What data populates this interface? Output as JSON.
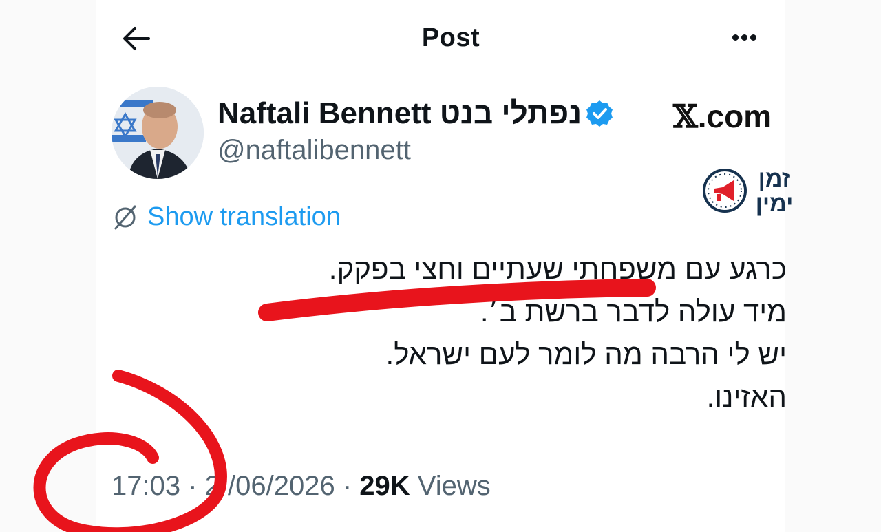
{
  "header": {
    "title": "Post",
    "back_icon": "arrow-left-icon",
    "more_icon": "more-horizontal-icon"
  },
  "author": {
    "display_name": "Naftali Bennett נפתלי בנט",
    "handle": "@naftalibennett",
    "verified": true,
    "verified_color": "#1d9bf0"
  },
  "watermark": {
    "site_x": "𝕏",
    "site_rest": ".com",
    "brand_line1": "זמן",
    "brand_line2": "ימין",
    "brand_color": "#16324f",
    "brand_accent": "#e0202a"
  },
  "translation": {
    "label": "Show translation",
    "color": "#1d9bf0"
  },
  "tweet": {
    "lines": [
      "כרגע עם משפחתי שעתיים וחצי בפקק.",
      "מיד עולה לדבר ברשת ב׳.",
      "יש לי הרבה מה לומר לעם ישראל.",
      "האזינו."
    ]
  },
  "meta": {
    "time": "17:03",
    "sep1": " · ",
    "date": "2 /06/2026",
    "sep2": " · ",
    "views_count": "29K",
    "views_label": " Views"
  },
  "annotations": {
    "marker_color": "#e8141c"
  }
}
